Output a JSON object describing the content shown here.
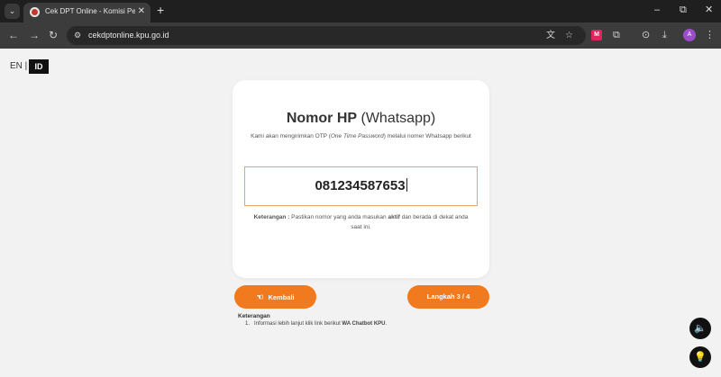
{
  "browser": {
    "tab_title": "Cek DPT Online - Komisi Pemili...",
    "tab_close": "✕",
    "new_tab": "+",
    "tab_search_icon": "chevron-down-icon",
    "window_controls": {
      "minimize": "–",
      "restore": "⧉",
      "close": "✕"
    },
    "url": "cekdptonline.kpu.go.id",
    "profile_initial": "A",
    "red_extension": "M"
  },
  "lang_switch": {
    "en": "EN |",
    "id": "ID"
  },
  "card": {
    "title_bold": "Nomor HP",
    "title_rest": " (Whatsapp)",
    "desc_1": "Kami akan mengirimkan OTP (",
    "desc_italic": "One Time Password",
    "desc_2": ") melalui nomer Whatsapp berikut",
    "phone_value": "081234587653",
    "note_label": "Keterangan :",
    "note_1": " Pastikan nomor yang anda masukan ",
    "note_bold": "aktif",
    "note_2": " dan berada di dekat anda saat ini."
  },
  "buttons": {
    "back_label": "Kembali",
    "next_label": "Langkah 3 / 4"
  },
  "info": {
    "heading": "Keterangan",
    "item_1_num": "1.",
    "item_1_text": "Informasi lebih lanjut klik link berikut ",
    "item_1_link": "WA Chatbot KPU",
    "item_1_end": "."
  },
  "colors": {
    "accent": "#f07a1d",
    "page_bg": "#f2f2f2",
    "chrome_dark": "#1f1f1f"
  }
}
